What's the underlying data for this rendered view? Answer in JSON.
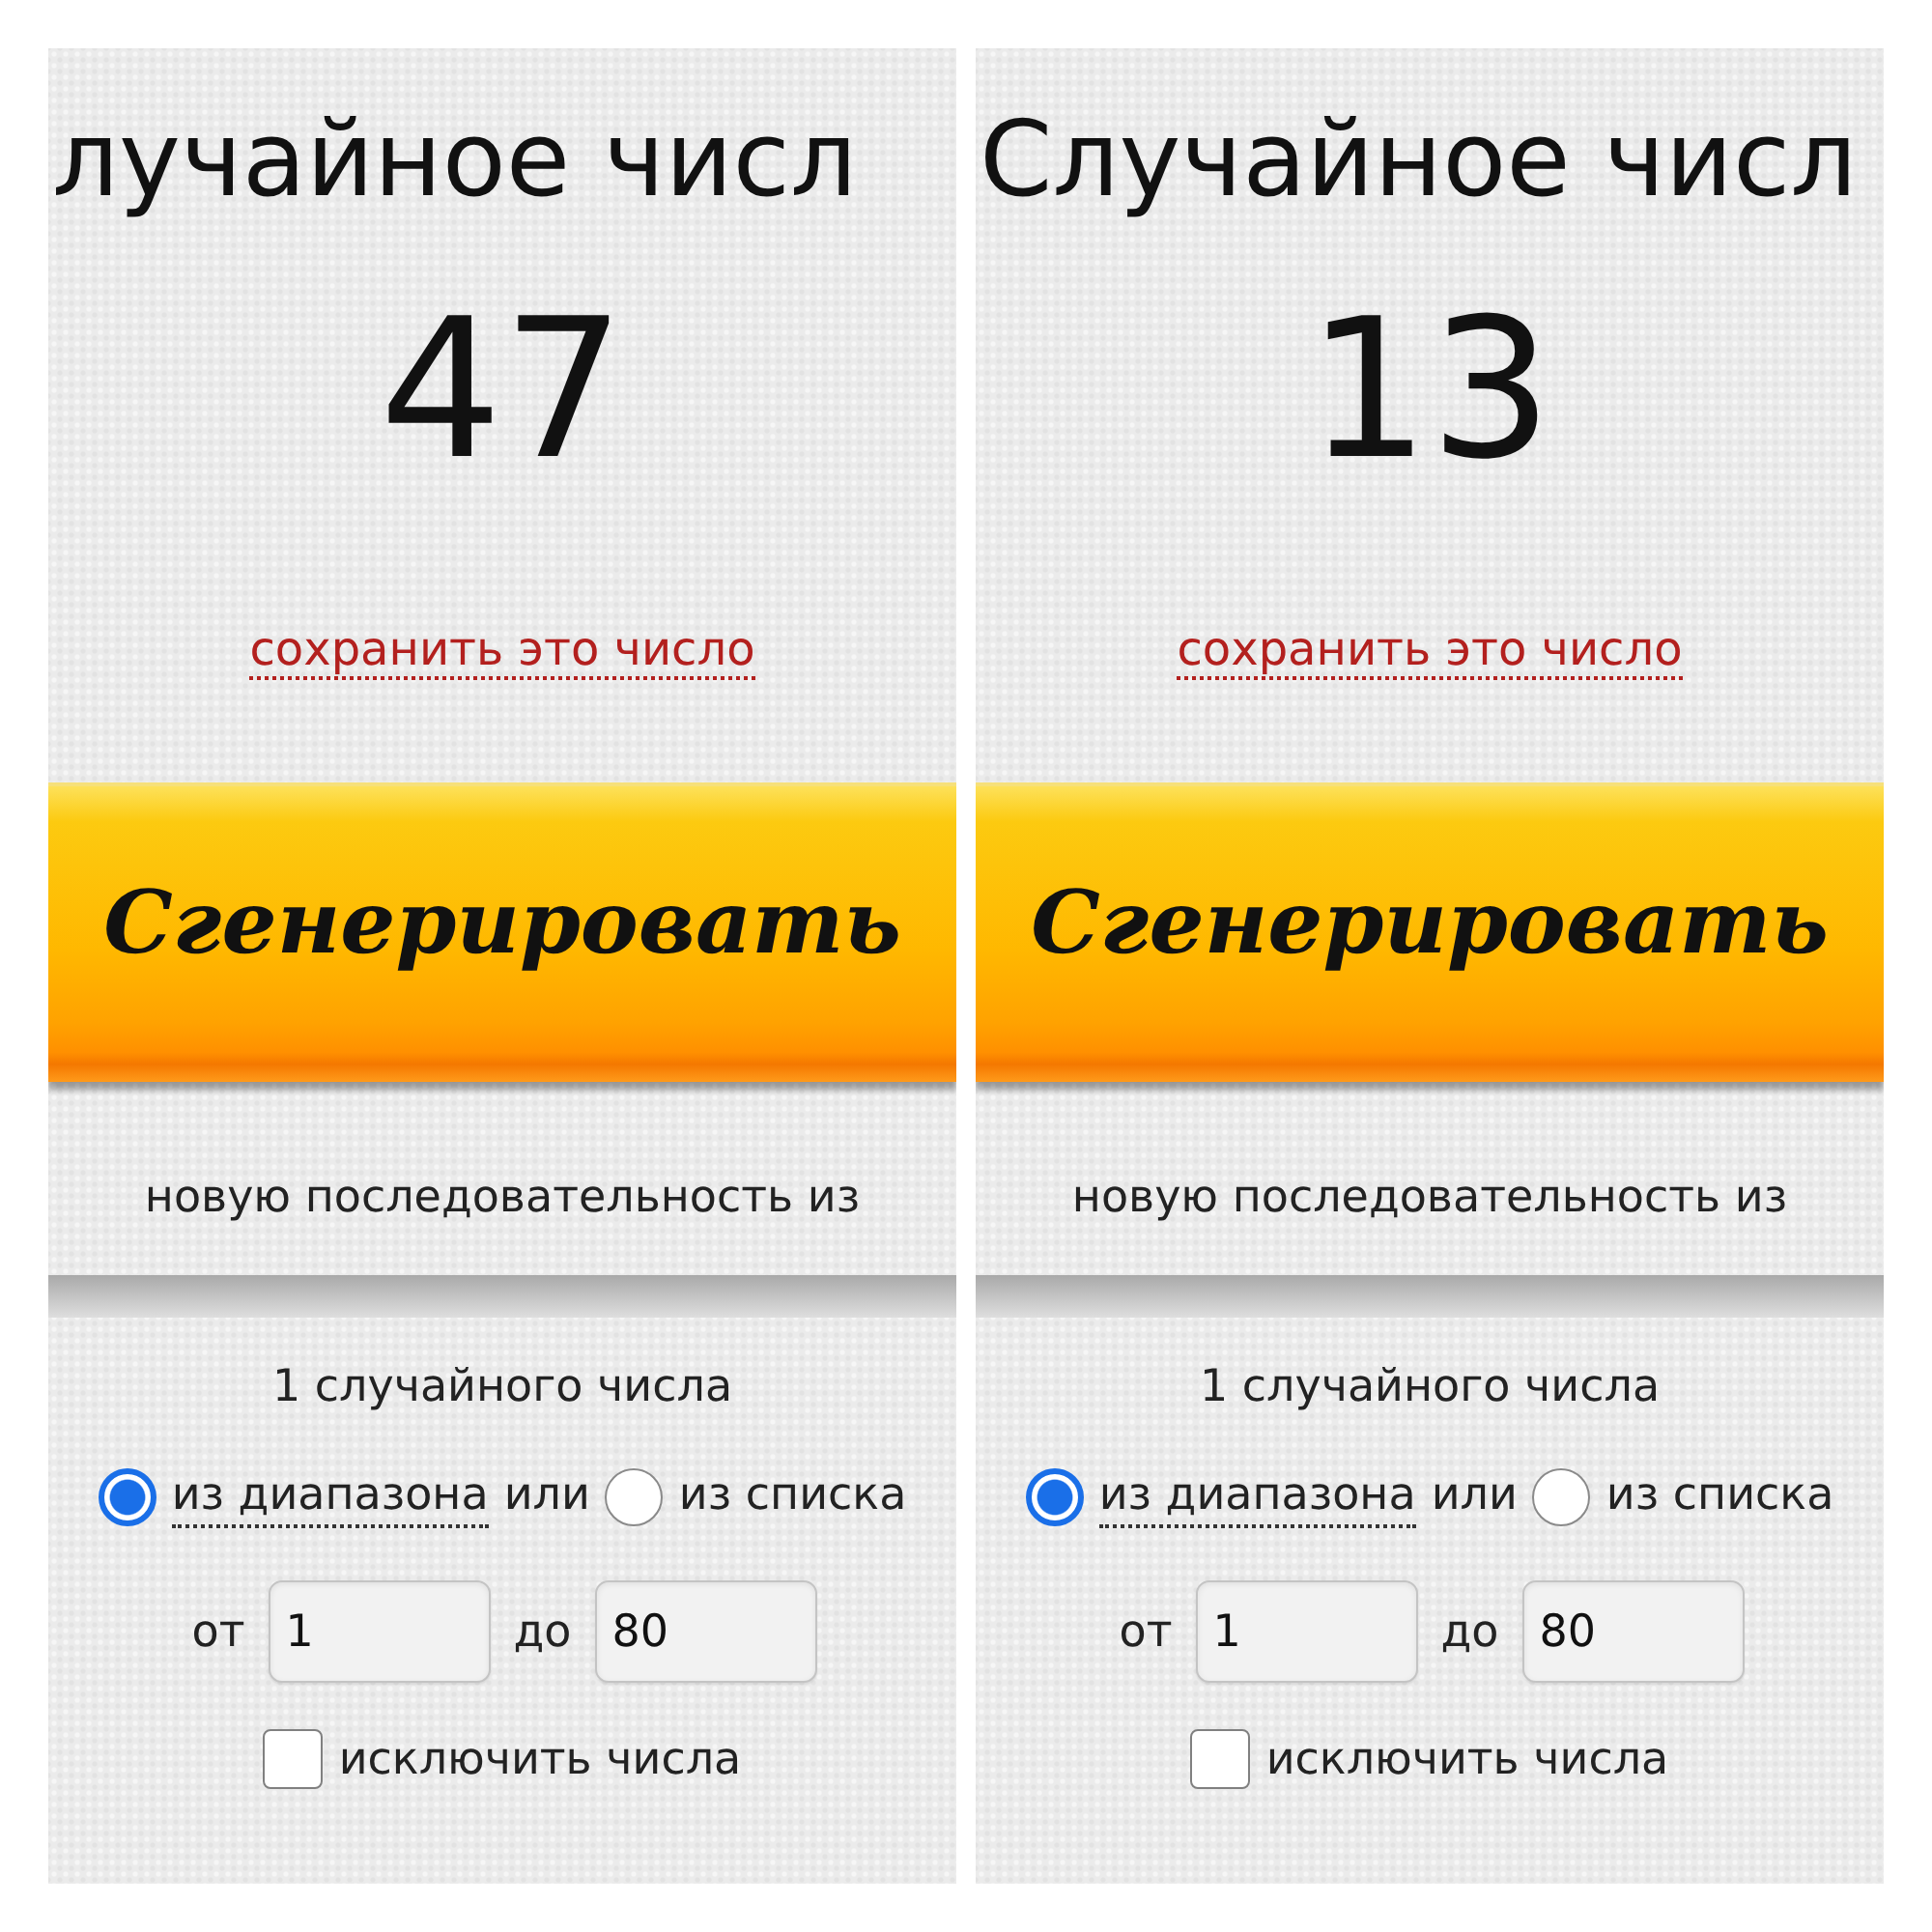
{
  "panels": [
    {
      "title": "лучайное числ",
      "result": "47",
      "save_link": "сохранить это число",
      "generate_button": "Сгенерировать",
      "mode_text": "новую последовательность из",
      "count_text": "1 случайного числа",
      "source_options": [
        {
          "label": "из диапазона",
          "kind": "link",
          "selected": true
        },
        {
          "label": "из списка",
          "kind": "text",
          "selected": false
        }
      ],
      "separator": "или",
      "range": {
        "from_label": "от",
        "from_value": "1",
        "to_label": "до",
        "to_value": "80"
      },
      "exclude": {
        "label": "исключить числа",
        "checked": false
      }
    },
    {
      "title": "Случайное числ",
      "result": "13",
      "save_link": "сохранить это число",
      "generate_button": "Сгенерировать",
      "mode_text": "новую последовательность из",
      "count_text": "1 случайного числа",
      "source_options": [
        {
          "label": "из диапазона",
          "kind": "link",
          "selected": true
        },
        {
          "label": "из списка",
          "kind": "text",
          "selected": false
        }
      ],
      "separator": "или",
      "range": {
        "from_label": "от",
        "from_value": "1",
        "to_label": "до",
        "to_value": "80"
      },
      "exclude": {
        "label": "исключить числа",
        "checked": false
      }
    }
  ]
}
